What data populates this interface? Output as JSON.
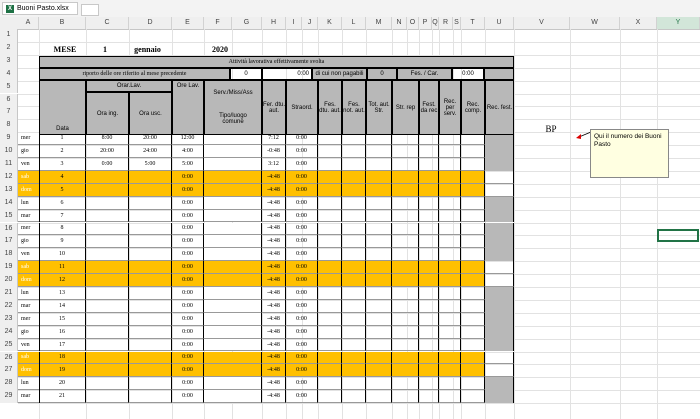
{
  "tab": {
    "filename": "Buoni Pasto.xlsx"
  },
  "columns": [
    "A",
    "B",
    "C",
    "D",
    "E",
    "F",
    "G",
    "H",
    "I",
    "J",
    "K",
    "L",
    "M",
    "N",
    "O",
    "P",
    "Q",
    "R",
    "S",
    "T",
    "U",
    "V",
    "W",
    "X",
    "Y"
  ],
  "rows": [
    "1",
    "2",
    "3",
    "4",
    "5",
    "6",
    "7",
    "8",
    "9",
    "10",
    "11",
    "12",
    "13",
    "14",
    "15",
    "16",
    "17",
    "18",
    "19",
    "20",
    "21",
    "22",
    "23",
    "24",
    "25",
    "26",
    "27",
    "28",
    "29"
  ],
  "header": {
    "mese_label": "MESE",
    "mese_num": "1",
    "mese_name": "gennaio",
    "anno": "2020",
    "attivita": "Attività lavorativa effettivamente svolta",
    "riporto": "riporto delle ore riferito al mese precedente",
    "riporto_val": "0",
    "h4_val": "0:00",
    "h4_label": "di cui non pagabili",
    "n4_val": "0",
    "fes_car": "Fes. / Car.",
    "fes_car_val": "0:00",
    "orar_lav": "Orar.Lav.",
    "ore_lav": "Ore Lav.",
    "serv": "Serv./Miss/Ass",
    "tipo": "Tipo/luogo comune",
    "data": "Data",
    "ora_ing": "Ora ing.",
    "ora_usc": "Ora usc.",
    "fer_dtu": "Fer. dtu. aut.",
    "straord": "Straord.",
    "fes_dtu": "Fes. dtu. aut.",
    "fes_not": "Fes. not. aut.",
    "tot_aut": "Tot. aut. Str.",
    "str_rep": "Str. rep",
    "fest_da": "Fest. da rec",
    "rec_per": "Rec. per serv.",
    "rec_comp": "Rec. comp.",
    "rec_fest": "Rec. fest."
  },
  "bp_label": "BP",
  "note_text": "Qui il numero dei Buoni Pasto",
  "days": [
    {
      "day": "mer",
      "n": "1",
      "ing": "8:00",
      "usc": "20:00",
      "ore": "12:00",
      "h": "7:12",
      "i": "0:00",
      "weekend": false
    },
    {
      "day": "gio",
      "n": "2",
      "ing": "20:00",
      "usc": "24:00",
      "ore": "4:00",
      "h": "-0:48",
      "i": "0:00",
      "weekend": false
    },
    {
      "day": "ven",
      "n": "3",
      "ing": "0:00",
      "usc": "5:00",
      "ore": "5:00",
      "h": "3:12",
      "i": "0:00",
      "weekend": false
    },
    {
      "day": "sab",
      "n": "4",
      "ing": "",
      "usc": "",
      "ore": "0:00",
      "h": "-4:48",
      "i": "0:00",
      "weekend": true
    },
    {
      "day": "dom",
      "n": "5",
      "ing": "",
      "usc": "",
      "ore": "0:00",
      "h": "-4:48",
      "i": "0:00",
      "weekend": true
    },
    {
      "day": "lun",
      "n": "6",
      "ing": "",
      "usc": "",
      "ore": "0:00",
      "h": "-4:48",
      "i": "0:00",
      "weekend": false
    },
    {
      "day": "mar",
      "n": "7",
      "ing": "",
      "usc": "",
      "ore": "0:00",
      "h": "-4:48",
      "i": "0:00",
      "weekend": false
    },
    {
      "day": "mer",
      "n": "8",
      "ing": "",
      "usc": "",
      "ore": "0:00",
      "h": "-4:48",
      "i": "0:00",
      "weekend": false
    },
    {
      "day": "gio",
      "n": "9",
      "ing": "",
      "usc": "",
      "ore": "0:00",
      "h": "-4:48",
      "i": "0:00",
      "weekend": false
    },
    {
      "day": "ven",
      "n": "10",
      "ing": "",
      "usc": "",
      "ore": "0:00",
      "h": "-4:48",
      "i": "0:00",
      "weekend": false
    },
    {
      "day": "sab",
      "n": "11",
      "ing": "",
      "usc": "",
      "ore": "0:00",
      "h": "-4:48",
      "i": "0:00",
      "weekend": true
    },
    {
      "day": "dom",
      "n": "12",
      "ing": "",
      "usc": "",
      "ore": "0:00",
      "h": "-4:48",
      "i": "0:00",
      "weekend": true
    },
    {
      "day": "lun",
      "n": "13",
      "ing": "",
      "usc": "",
      "ore": "0:00",
      "h": "-4:48",
      "i": "0:00",
      "weekend": false
    },
    {
      "day": "mar",
      "n": "14",
      "ing": "",
      "usc": "",
      "ore": "0:00",
      "h": "-4:48",
      "i": "0:00",
      "weekend": false
    },
    {
      "day": "mer",
      "n": "15",
      "ing": "",
      "usc": "",
      "ore": "0:00",
      "h": "-4:48",
      "i": "0:00",
      "weekend": false
    },
    {
      "day": "gio",
      "n": "16",
      "ing": "",
      "usc": "",
      "ore": "0:00",
      "h": "-4:48",
      "i": "0:00",
      "weekend": false
    },
    {
      "day": "ven",
      "n": "17",
      "ing": "",
      "usc": "",
      "ore": "0:00",
      "h": "-4:48",
      "i": "0:00",
      "weekend": false
    },
    {
      "day": "sab",
      "n": "18",
      "ing": "",
      "usc": "",
      "ore": "0:00",
      "h": "-4:48",
      "i": "0:00",
      "weekend": true
    },
    {
      "day": "dom",
      "n": "19",
      "ing": "",
      "usc": "",
      "ore": "0:00",
      "h": "-4:48",
      "i": "0:00",
      "weekend": true
    },
    {
      "day": "lun",
      "n": "20",
      "ing": "",
      "usc": "",
      "ore": "0:00",
      "h": "-4:48",
      "i": "0:00",
      "weekend": false
    },
    {
      "day": "mar",
      "n": "21",
      "ing": "",
      "usc": "",
      "ore": "0:00",
      "h": "-4:48",
      "i": "0:00",
      "weekend": false
    }
  ]
}
